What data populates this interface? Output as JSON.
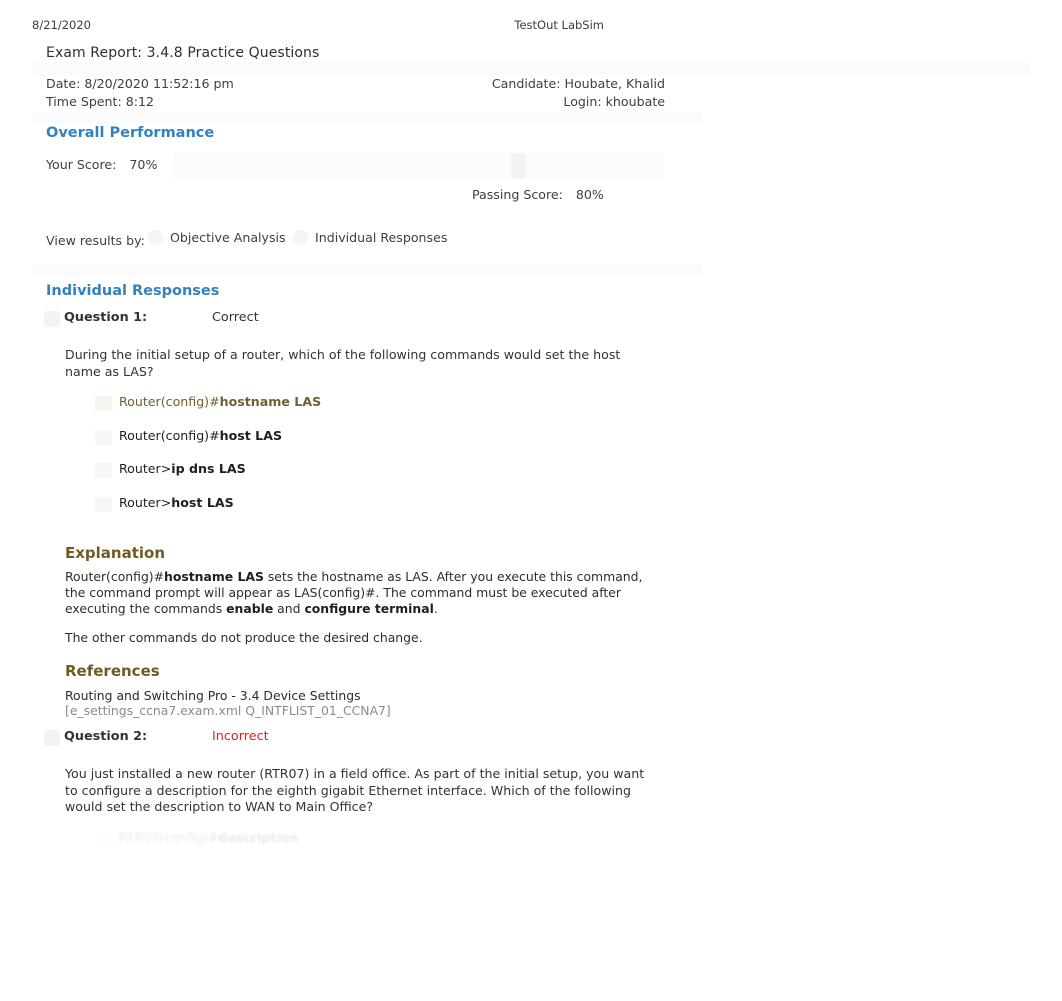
{
  "print_header": {
    "date": "8/21/2020",
    "app_title": "TestOut LabSim"
  },
  "report": {
    "title": "Exam Report: 3.4.8 Practice Questions",
    "date_label": "Date:",
    "date_value": "8/20/2020 11:52:16 pm",
    "time_spent_label": "Time Spent:",
    "time_spent_value": "8:12",
    "candidate_label": "Candidate:",
    "candidate_value": "Houbate, Khalid",
    "login_label": "Login:",
    "login_value": "khoubate"
  },
  "overall_performance": {
    "heading": "Overall Performance",
    "your_score_label": "Your Score:",
    "your_score_value": "70%",
    "passing_score_label": "Passing Score:",
    "passing_score_value": "80%",
    "score_percent": 70,
    "passing_percent": 80,
    "accent_color": "#3580bd"
  },
  "view_results_by": {
    "label": "View results by:",
    "options": [
      {
        "label": "Objective Analysis",
        "selected": false
      },
      {
        "label": "Individual Responses",
        "selected": true
      }
    ]
  },
  "individual_responses": {
    "heading": "Individual Responses",
    "questions": [
      {
        "label": "Question 1:",
        "result": "Correct",
        "result_state": "correct",
        "text": "During the initial setup of a router, which of the following commands would set the host name as LAS?",
        "options": [
          {
            "prefix": "Router(config)#",
            "command": "hostname LAS",
            "chosen": true
          },
          {
            "prefix": "Router(config)#",
            "command": "host LAS",
            "chosen": false
          },
          {
            "prefix": "Router>",
            "command": "ip dns LAS",
            "chosen": false
          },
          {
            "prefix": "Router>",
            "command": "host LAS",
            "chosen": false
          }
        ],
        "explanation_heading": "Explanation",
        "explanation_p1_pre": "Router(config)#",
        "explanation_p1_b1": "hostname LAS",
        "explanation_p1_mid": " sets the hostname as LAS. After you execute this command, the command prompt will appear as LAS(config)#. The command must be executed after executing the commands ",
        "explanation_p1_b2": "enable",
        "explanation_p1_mid2": " and ",
        "explanation_p1_b3": "configure terminal",
        "explanation_p1_end": ".",
        "explanation_p2": "The other commands do not produce the desired change.",
        "references_heading": "References",
        "reference_line": "Routing and Switching Pro - 3.4 Device Settings",
        "reference_id": "[e_settings_ccna7.exam.xml Q_INTFLIST_01_CCNA7]"
      },
      {
        "label": "Question 2:",
        "result": "Incorrect",
        "result_state": "incorrect",
        "text": "You just installed a new router (RTR07) in a field office. As part of the initial setup, you want to configure a description for the eighth gigabit Ethernet interface. Which of the following would set the description to WAN to Main Office?",
        "options": [
          {
            "prefix": "RTR07(config)#",
            "command": "description",
            "chosen": true
          }
        ]
      }
    ]
  }
}
